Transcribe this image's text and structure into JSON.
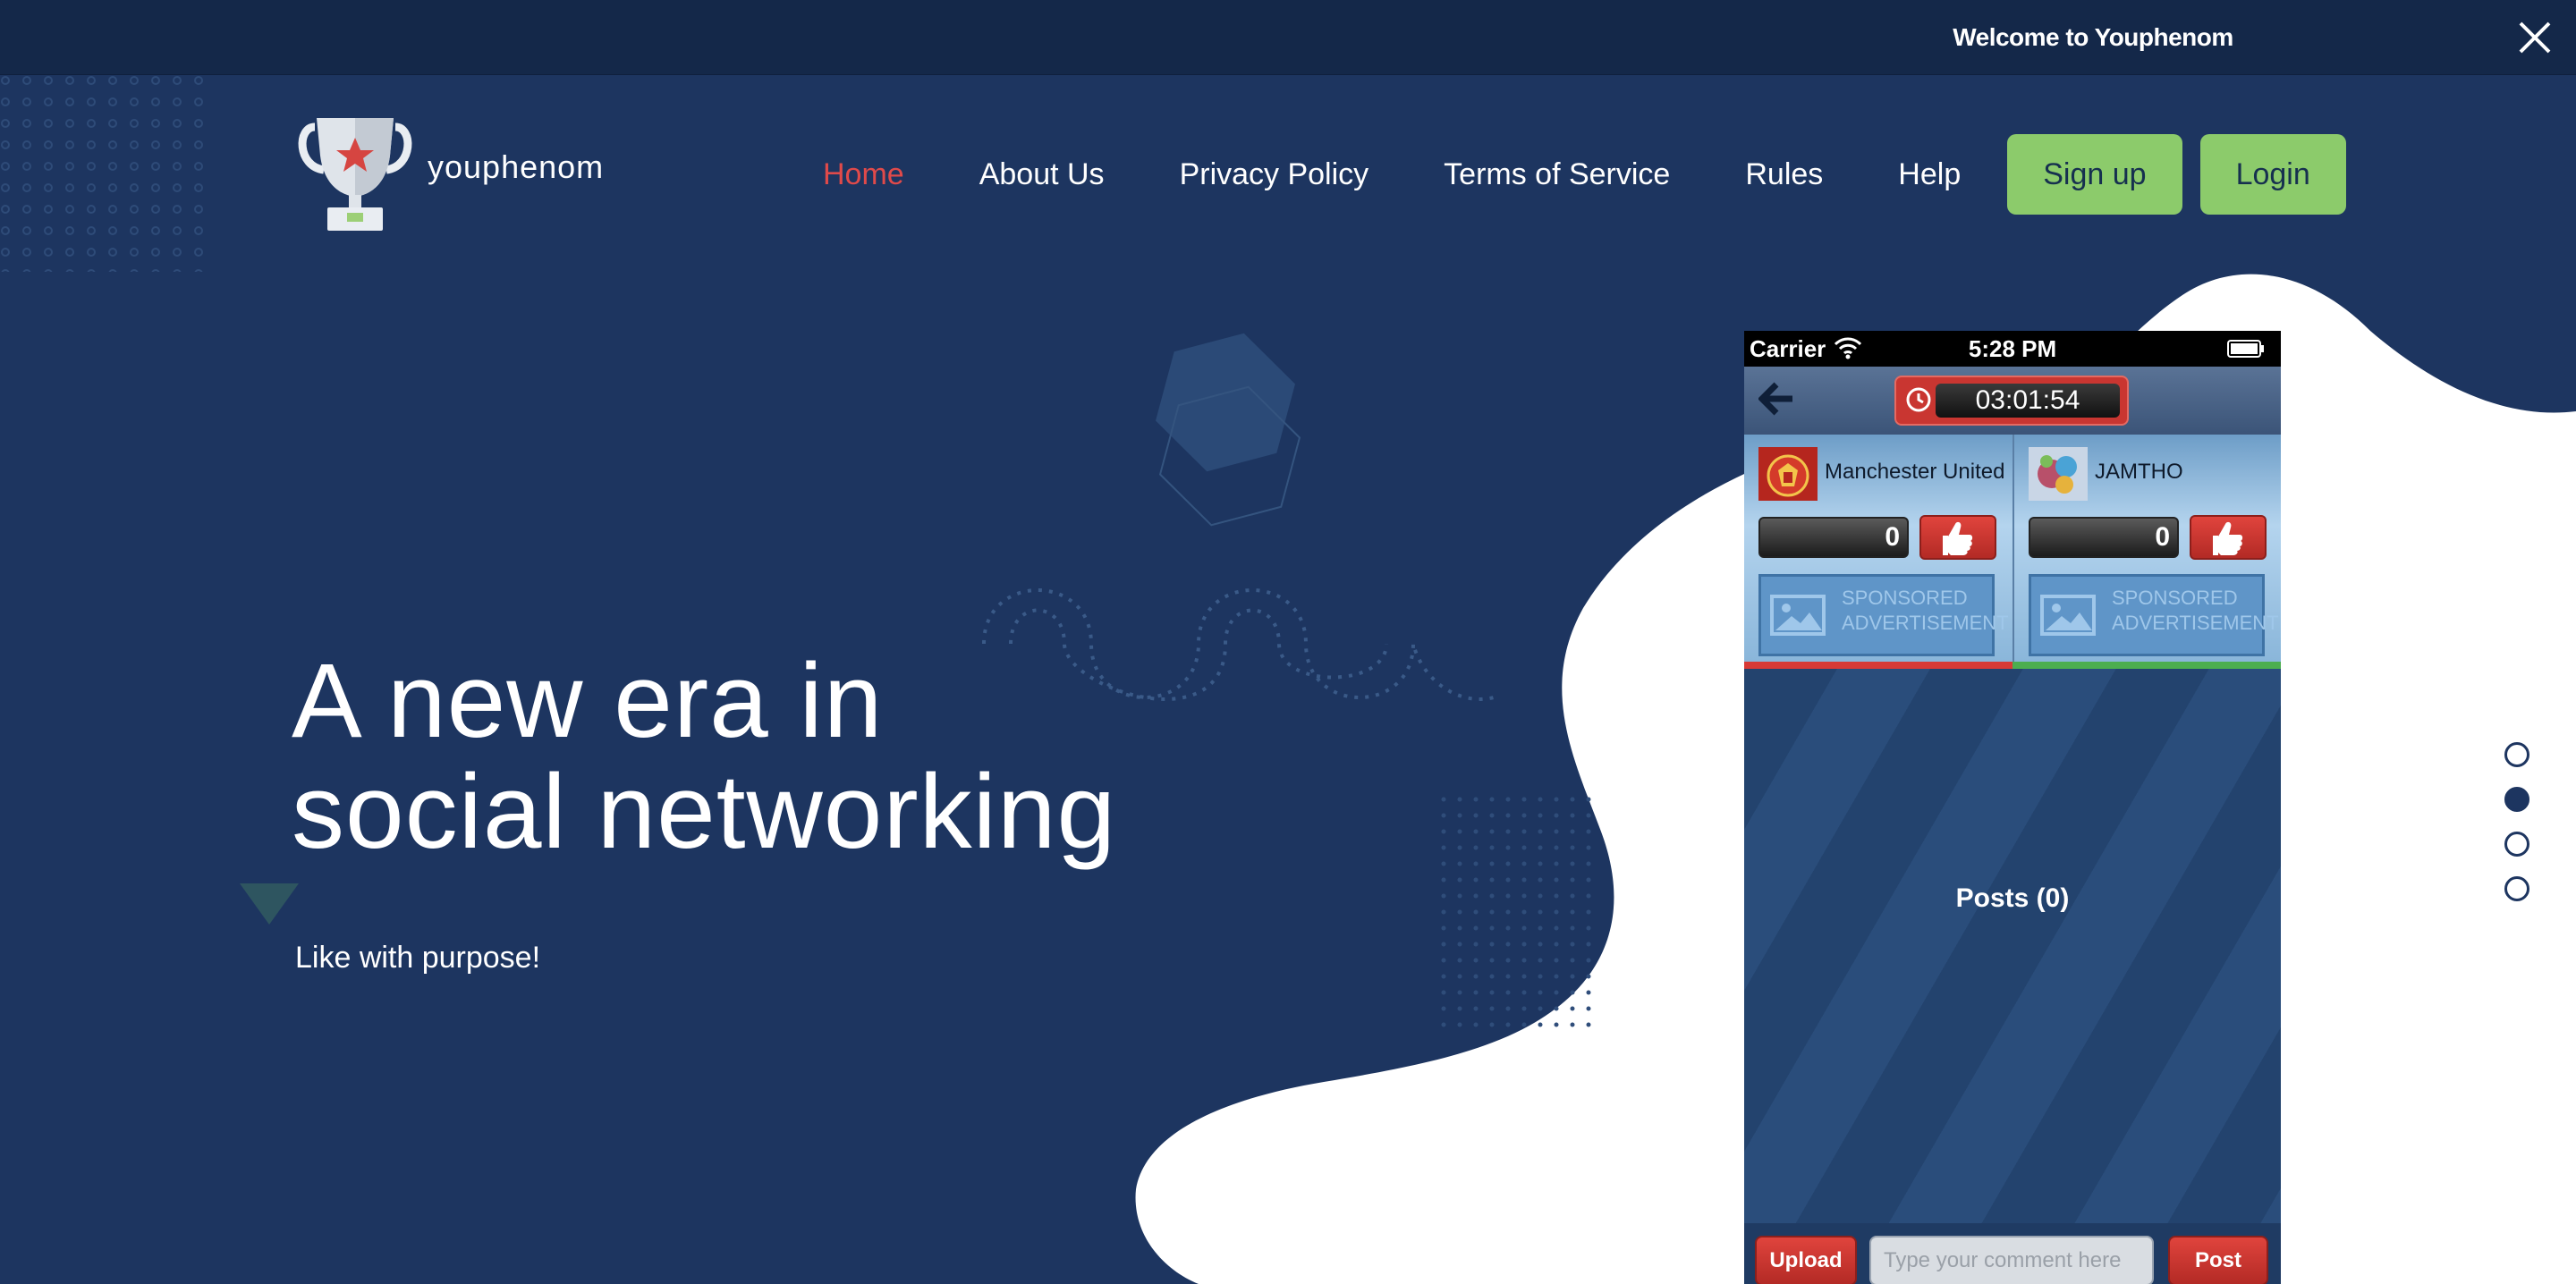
{
  "topbar": {
    "welcome": "Welcome to Youphenom"
  },
  "brand": {
    "name": "youphenom"
  },
  "nav": {
    "items": [
      {
        "label": "Home",
        "active": true
      },
      {
        "label": "About Us"
      },
      {
        "label": "Privacy Policy"
      },
      {
        "label": "Terms of Service"
      },
      {
        "label": "Rules"
      },
      {
        "label": "Help"
      }
    ],
    "signup_label": "Sign up",
    "login_label": "Login"
  },
  "hero": {
    "title_line1": "A new era in",
    "title_line2": "social networking",
    "subtitle": "Like with purpose!"
  },
  "pager": {
    "count": 4,
    "active_index": 1
  },
  "phone": {
    "status": {
      "carrier": "Carrier",
      "time": "5:28 PM"
    },
    "timer": "03:01:54",
    "teams": [
      {
        "name": "Manchester United",
        "score": "0",
        "sponsor_line1": "SPONSORED",
        "sponsor_line2": "ADVERTISEMENT"
      },
      {
        "name": "JAMTHO",
        "score": "0",
        "sponsor_line1": "SPONSORED",
        "sponsor_line2": "ADVERTISEMENT"
      }
    ],
    "posts_label": "Posts (0)",
    "upload_label": "Upload",
    "comment_placeholder": "Type your comment here",
    "post_label": "Post"
  },
  "colors": {
    "background": "#1d3560",
    "topbar": "#142849",
    "nav_active": "#e04a4a",
    "button_green": "#8ccb6b",
    "button_red": "#c93631",
    "divider_red": "#d83a36",
    "divider_green": "#4cae4f"
  }
}
